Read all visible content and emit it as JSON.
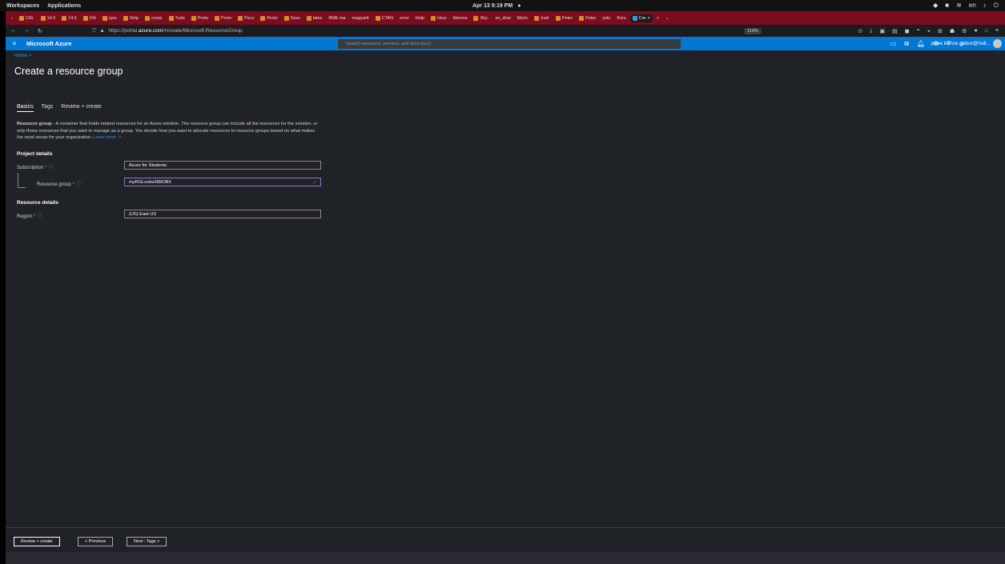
{
  "system": {
    "left": [
      "Workspaces",
      "Applications"
    ],
    "datetime": "Apr 13  9:19 PM",
    "status_dot": "●",
    "lang": "en"
  },
  "browser": {
    "tabs": [
      "130.",
      "14.5",
      "14.5",
      "RA",
      "cpiu",
      "Strip",
      "comp",
      "Tudo",
      "Proto",
      "Proto",
      "Pecs",
      "Proto",
      "Sess",
      "latex",
      "BME ma",
      "magyarit",
      "CTAN",
      "error",
      "Help",
      "Hour",
      "libnova",
      "Sky-",
      "en_dow",
      "Meric",
      "Instr",
      "Peter",
      "Peter",
      "yolo",
      "Kors",
      "Cre"
    ],
    "url_prefix": "https://portal.",
    "url_host": "azure.com",
    "url_path": "/#create/Microsoft.ResourceGroup",
    "zoom": "110%"
  },
  "azure": {
    "brand": "Microsoft Azure",
    "search_placeholder": "Search resources, services, and docs (G+/)",
    "user": "peter.bence.gabor@hall..."
  },
  "page": {
    "breadcrumb": "Home",
    "breadcrumb_sep": ">",
    "title": "Create a resource group",
    "tabs": [
      "Basics",
      "Tags",
      "Review + create"
    ],
    "desc_bold": "Resource group",
    "desc_text": " - A container that holds related resources for an Azure solution. The resource group can include all the resources for the solution, or only those resources that you want to manage as a group. You decide how you want to allocate resources to resource groups based on what makes the most sense for your organization. ",
    "learn_more": "Learn more",
    "project_details": "Project details",
    "subscription_label": "Subscription",
    "subscription_value": "Azure for Students",
    "rg_label": "Resource group",
    "rg_value": "myRGLocksX89OBX",
    "resource_details": "Resource details",
    "region_label": "Region",
    "region_value": "(US) East US",
    "required": "*",
    "info": "ⓘ",
    "check": "✓"
  },
  "footer": {
    "review": "Review + create",
    "previous": "< Previous",
    "next": "Next : Tags >"
  }
}
